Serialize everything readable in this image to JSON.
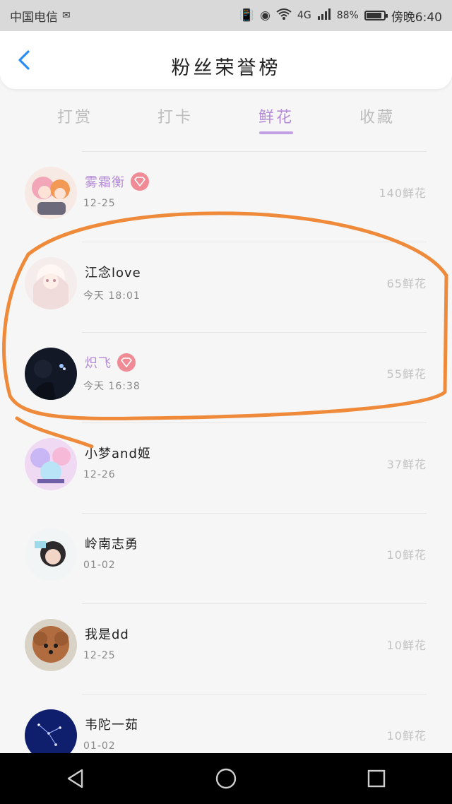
{
  "status_bar": {
    "carrier": "中国电信",
    "network": "4G",
    "battery_percent": "88%",
    "battery_level": 0.88,
    "time": "傍晚6:40"
  },
  "header": {
    "title": "粉丝荣誉榜"
  },
  "tabs": [
    {
      "label": "打赏",
      "active": false
    },
    {
      "label": "打卡",
      "active": false
    },
    {
      "label": "鲜花",
      "active": true
    },
    {
      "label": "收藏",
      "active": false
    }
  ],
  "fans": [
    {
      "name": "雾霜衡",
      "date": "12-25",
      "count": "140鲜花",
      "vip": true
    },
    {
      "name": "江念love",
      "date": "今天 18:01",
      "count": "65鲜花",
      "vip": false
    },
    {
      "name": "炽飞",
      "date": "今天 16:38",
      "count": "55鲜花",
      "vip": true
    },
    {
      "name": "小梦and姬",
      "date": "12-26",
      "count": "37鲜花",
      "vip": false
    },
    {
      "name": "岭南志勇",
      "date": "01-02",
      "count": "10鲜花",
      "vip": false
    },
    {
      "name": "我是dd",
      "date": "12-25",
      "count": "10鲜花",
      "vip": false
    },
    {
      "name": "韦陀一茹",
      "date": "01-02",
      "count": "10鲜花",
      "vip": false
    }
  ],
  "colors": {
    "accent": "#b48ad6",
    "badge": "#f08a95",
    "annotation": "#ee8a3a",
    "back_arrow": "#2a8bf2"
  }
}
